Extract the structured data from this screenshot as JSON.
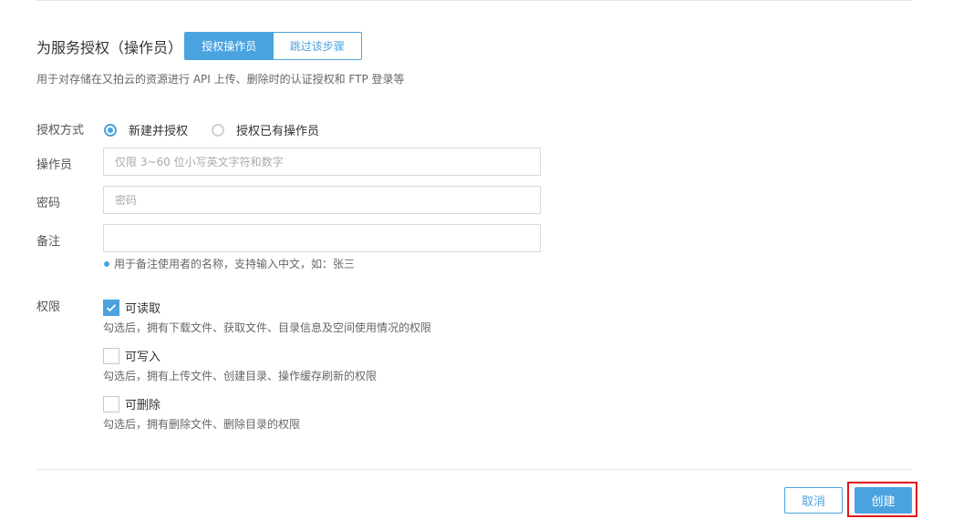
{
  "section": {
    "title": "为服务授权（操作员）",
    "toggle": {
      "active_label": "授权操作员",
      "inactive_label": "跳过该步骤"
    },
    "description": "用于对存储在又拍云的资源进行 API 上传、删除时的认证授权和 FTP 登录等"
  },
  "form": {
    "auth_method": {
      "label": "授权方式",
      "options": [
        {
          "label": "新建并授权",
          "selected": true
        },
        {
          "label": "授权已有操作员",
          "selected": false
        }
      ]
    },
    "operator": {
      "label": "操作员",
      "value": "",
      "placeholder": "仅限 3~60 位小写英文字符和数字"
    },
    "password": {
      "label": "密码",
      "value": "",
      "placeholder": "密码"
    },
    "remark": {
      "label": "备注",
      "value": "",
      "placeholder": "",
      "hint": "用于备注使用者的名称，支持输入中文，如：张三"
    },
    "permissions": {
      "label": "权限",
      "items": [
        {
          "label": "可读取",
          "checked": true,
          "description": "勾选后，拥有下载文件、获取文件、目录信息及空间使用情况的权限"
        },
        {
          "label": "可写入",
          "checked": false,
          "description": "勾选后，拥有上传文件、创建目录、操作缓存刷新的权限"
        },
        {
          "label": "可删除",
          "checked": false,
          "description": "勾选后，拥有删除文件、删除目录的权限"
        }
      ]
    }
  },
  "footer": {
    "cancel_label": "取消",
    "create_label": "创建"
  },
  "colors": {
    "accent": "#4aa3df",
    "highlight": "#e01818"
  }
}
